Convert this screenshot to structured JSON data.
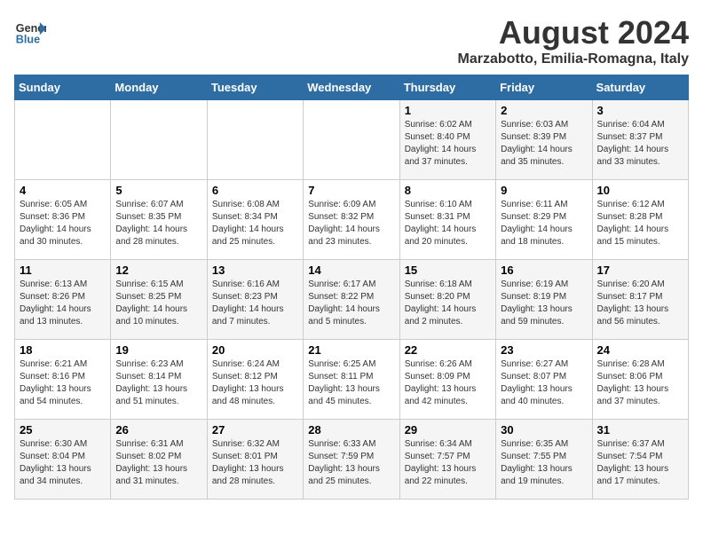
{
  "header": {
    "logo_line1": "General",
    "logo_line2": "Blue",
    "title": "August 2024",
    "subtitle": "Marzabotto, Emilia-Romagna, Italy"
  },
  "days_of_week": [
    "Sunday",
    "Monday",
    "Tuesday",
    "Wednesday",
    "Thursday",
    "Friday",
    "Saturday"
  ],
  "weeks": [
    [
      {
        "day": "",
        "info": ""
      },
      {
        "day": "",
        "info": ""
      },
      {
        "day": "",
        "info": ""
      },
      {
        "day": "",
        "info": ""
      },
      {
        "day": "1",
        "info": "Sunrise: 6:02 AM\nSunset: 8:40 PM\nDaylight: 14 hours\nand 37 minutes."
      },
      {
        "day": "2",
        "info": "Sunrise: 6:03 AM\nSunset: 8:39 PM\nDaylight: 14 hours\nand 35 minutes."
      },
      {
        "day": "3",
        "info": "Sunrise: 6:04 AM\nSunset: 8:37 PM\nDaylight: 14 hours\nand 33 minutes."
      }
    ],
    [
      {
        "day": "4",
        "info": "Sunrise: 6:05 AM\nSunset: 8:36 PM\nDaylight: 14 hours\nand 30 minutes."
      },
      {
        "day": "5",
        "info": "Sunrise: 6:07 AM\nSunset: 8:35 PM\nDaylight: 14 hours\nand 28 minutes."
      },
      {
        "day": "6",
        "info": "Sunrise: 6:08 AM\nSunset: 8:34 PM\nDaylight: 14 hours\nand 25 minutes."
      },
      {
        "day": "7",
        "info": "Sunrise: 6:09 AM\nSunset: 8:32 PM\nDaylight: 14 hours\nand 23 minutes."
      },
      {
        "day": "8",
        "info": "Sunrise: 6:10 AM\nSunset: 8:31 PM\nDaylight: 14 hours\nand 20 minutes."
      },
      {
        "day": "9",
        "info": "Sunrise: 6:11 AM\nSunset: 8:29 PM\nDaylight: 14 hours\nand 18 minutes."
      },
      {
        "day": "10",
        "info": "Sunrise: 6:12 AM\nSunset: 8:28 PM\nDaylight: 14 hours\nand 15 minutes."
      }
    ],
    [
      {
        "day": "11",
        "info": "Sunrise: 6:13 AM\nSunset: 8:26 PM\nDaylight: 14 hours\nand 13 minutes."
      },
      {
        "day": "12",
        "info": "Sunrise: 6:15 AM\nSunset: 8:25 PM\nDaylight: 14 hours\nand 10 minutes."
      },
      {
        "day": "13",
        "info": "Sunrise: 6:16 AM\nSunset: 8:23 PM\nDaylight: 14 hours\nand 7 minutes."
      },
      {
        "day": "14",
        "info": "Sunrise: 6:17 AM\nSunset: 8:22 PM\nDaylight: 14 hours\nand 5 minutes."
      },
      {
        "day": "15",
        "info": "Sunrise: 6:18 AM\nSunset: 8:20 PM\nDaylight: 14 hours\nand 2 minutes."
      },
      {
        "day": "16",
        "info": "Sunrise: 6:19 AM\nSunset: 8:19 PM\nDaylight: 13 hours\nand 59 minutes."
      },
      {
        "day": "17",
        "info": "Sunrise: 6:20 AM\nSunset: 8:17 PM\nDaylight: 13 hours\nand 56 minutes."
      }
    ],
    [
      {
        "day": "18",
        "info": "Sunrise: 6:21 AM\nSunset: 8:16 PM\nDaylight: 13 hours\nand 54 minutes."
      },
      {
        "day": "19",
        "info": "Sunrise: 6:23 AM\nSunset: 8:14 PM\nDaylight: 13 hours\nand 51 minutes."
      },
      {
        "day": "20",
        "info": "Sunrise: 6:24 AM\nSunset: 8:12 PM\nDaylight: 13 hours\nand 48 minutes."
      },
      {
        "day": "21",
        "info": "Sunrise: 6:25 AM\nSunset: 8:11 PM\nDaylight: 13 hours\nand 45 minutes."
      },
      {
        "day": "22",
        "info": "Sunrise: 6:26 AM\nSunset: 8:09 PM\nDaylight: 13 hours\nand 42 minutes."
      },
      {
        "day": "23",
        "info": "Sunrise: 6:27 AM\nSunset: 8:07 PM\nDaylight: 13 hours\nand 40 minutes."
      },
      {
        "day": "24",
        "info": "Sunrise: 6:28 AM\nSunset: 8:06 PM\nDaylight: 13 hours\nand 37 minutes."
      }
    ],
    [
      {
        "day": "25",
        "info": "Sunrise: 6:30 AM\nSunset: 8:04 PM\nDaylight: 13 hours\nand 34 minutes."
      },
      {
        "day": "26",
        "info": "Sunrise: 6:31 AM\nSunset: 8:02 PM\nDaylight: 13 hours\nand 31 minutes."
      },
      {
        "day": "27",
        "info": "Sunrise: 6:32 AM\nSunset: 8:01 PM\nDaylight: 13 hours\nand 28 minutes."
      },
      {
        "day": "28",
        "info": "Sunrise: 6:33 AM\nSunset: 7:59 PM\nDaylight: 13 hours\nand 25 minutes."
      },
      {
        "day": "29",
        "info": "Sunrise: 6:34 AM\nSunset: 7:57 PM\nDaylight: 13 hours\nand 22 minutes."
      },
      {
        "day": "30",
        "info": "Sunrise: 6:35 AM\nSunset: 7:55 PM\nDaylight: 13 hours\nand 19 minutes."
      },
      {
        "day": "31",
        "info": "Sunrise: 6:37 AM\nSunset: 7:54 PM\nDaylight: 13 hours\nand 17 minutes."
      }
    ]
  ]
}
